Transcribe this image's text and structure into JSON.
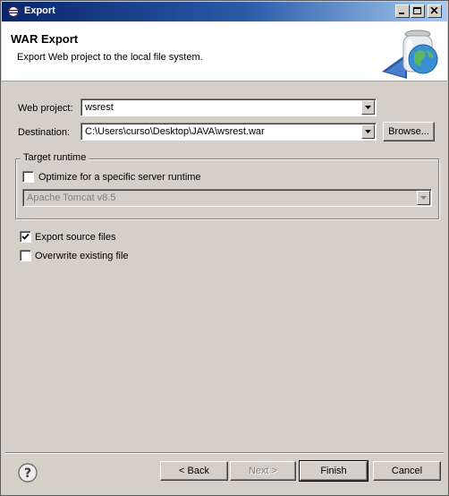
{
  "window": {
    "title": "Export"
  },
  "banner": {
    "title": "WAR Export",
    "description": "Export Web project to the local file system."
  },
  "form": {
    "web_project_label": "Web project:",
    "web_project_value": "wsrest",
    "destination_label": "Destination:",
    "destination_value": "C:\\Users\\curso\\Desktop\\JAVA\\wsrest.war",
    "browse_label": "Browse..."
  },
  "target_runtime": {
    "group_title": "Target runtime",
    "optimize_label": "Optimize for a specific server runtime",
    "optimize_checked": false,
    "runtime_value": "Apache Tomcat v8.5"
  },
  "options": {
    "export_source_label": "Export source files",
    "export_source_checked": true,
    "overwrite_label": "Overwrite existing file",
    "overwrite_checked": false
  },
  "footer": {
    "back_label": "< Back",
    "next_label": "Next >",
    "finish_label": "Finish",
    "cancel_label": "Cancel"
  },
  "icons": {
    "app": "eclipse-icon",
    "help": "help-icon",
    "banner": "war-jar-globe-icon"
  }
}
